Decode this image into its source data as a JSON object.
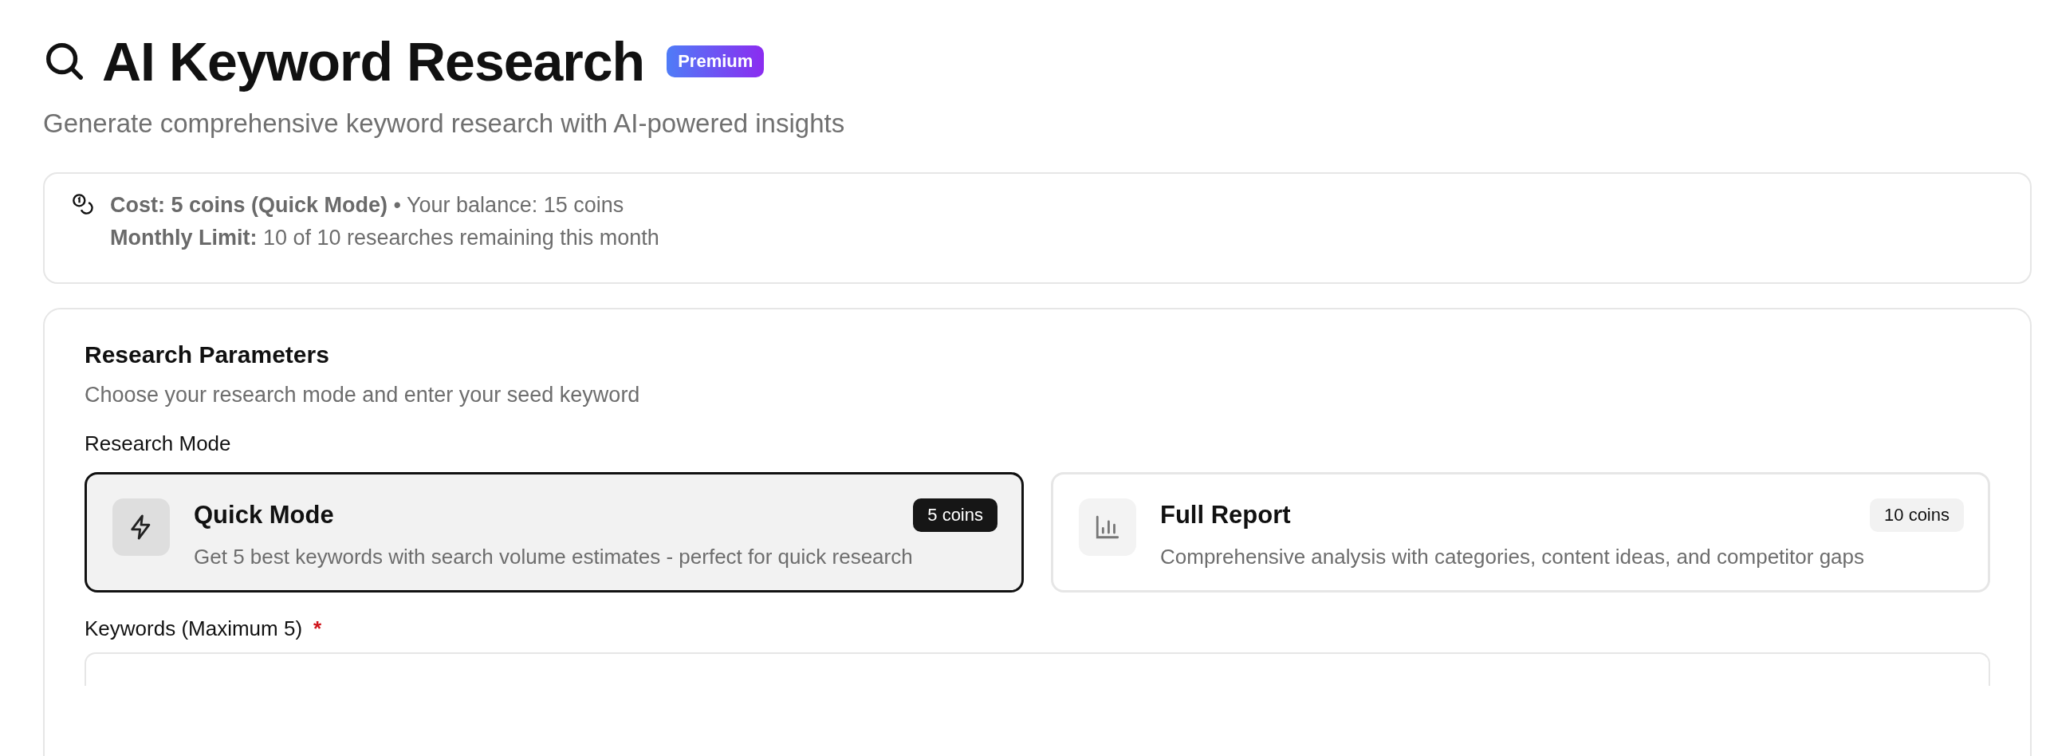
{
  "header": {
    "title": "AI Keyword Research",
    "badge": "Premium",
    "subtitle": "Generate comprehensive keyword research with AI-powered insights"
  },
  "cost_info": {
    "cost": "Cost: 5 coins (Quick Mode)",
    "separator": "•",
    "balance": "Your balance: 15 coins",
    "limit_label": "Monthly Limit:",
    "limit": "10 of 10 researches remaining this month"
  },
  "parameters": {
    "title": "Research Parameters",
    "subtitle": "Choose your research mode and enter your seed keyword",
    "mode_label": "Research Mode",
    "modes": [
      {
        "kind": "quick",
        "title": "Quick Mode",
        "price": "5 coins",
        "description": "Get 5 best keywords with search volume estimates - perfect for quick research",
        "selected": true
      },
      {
        "kind": "full",
        "title": "Full Report",
        "price": "10 coins",
        "description": "Comprehensive analysis with categories, content ideas, and competitor gaps",
        "selected": false
      }
    ],
    "keywords_label": "Keywords (Maximum 5)",
    "required_mark": "*"
  }
}
